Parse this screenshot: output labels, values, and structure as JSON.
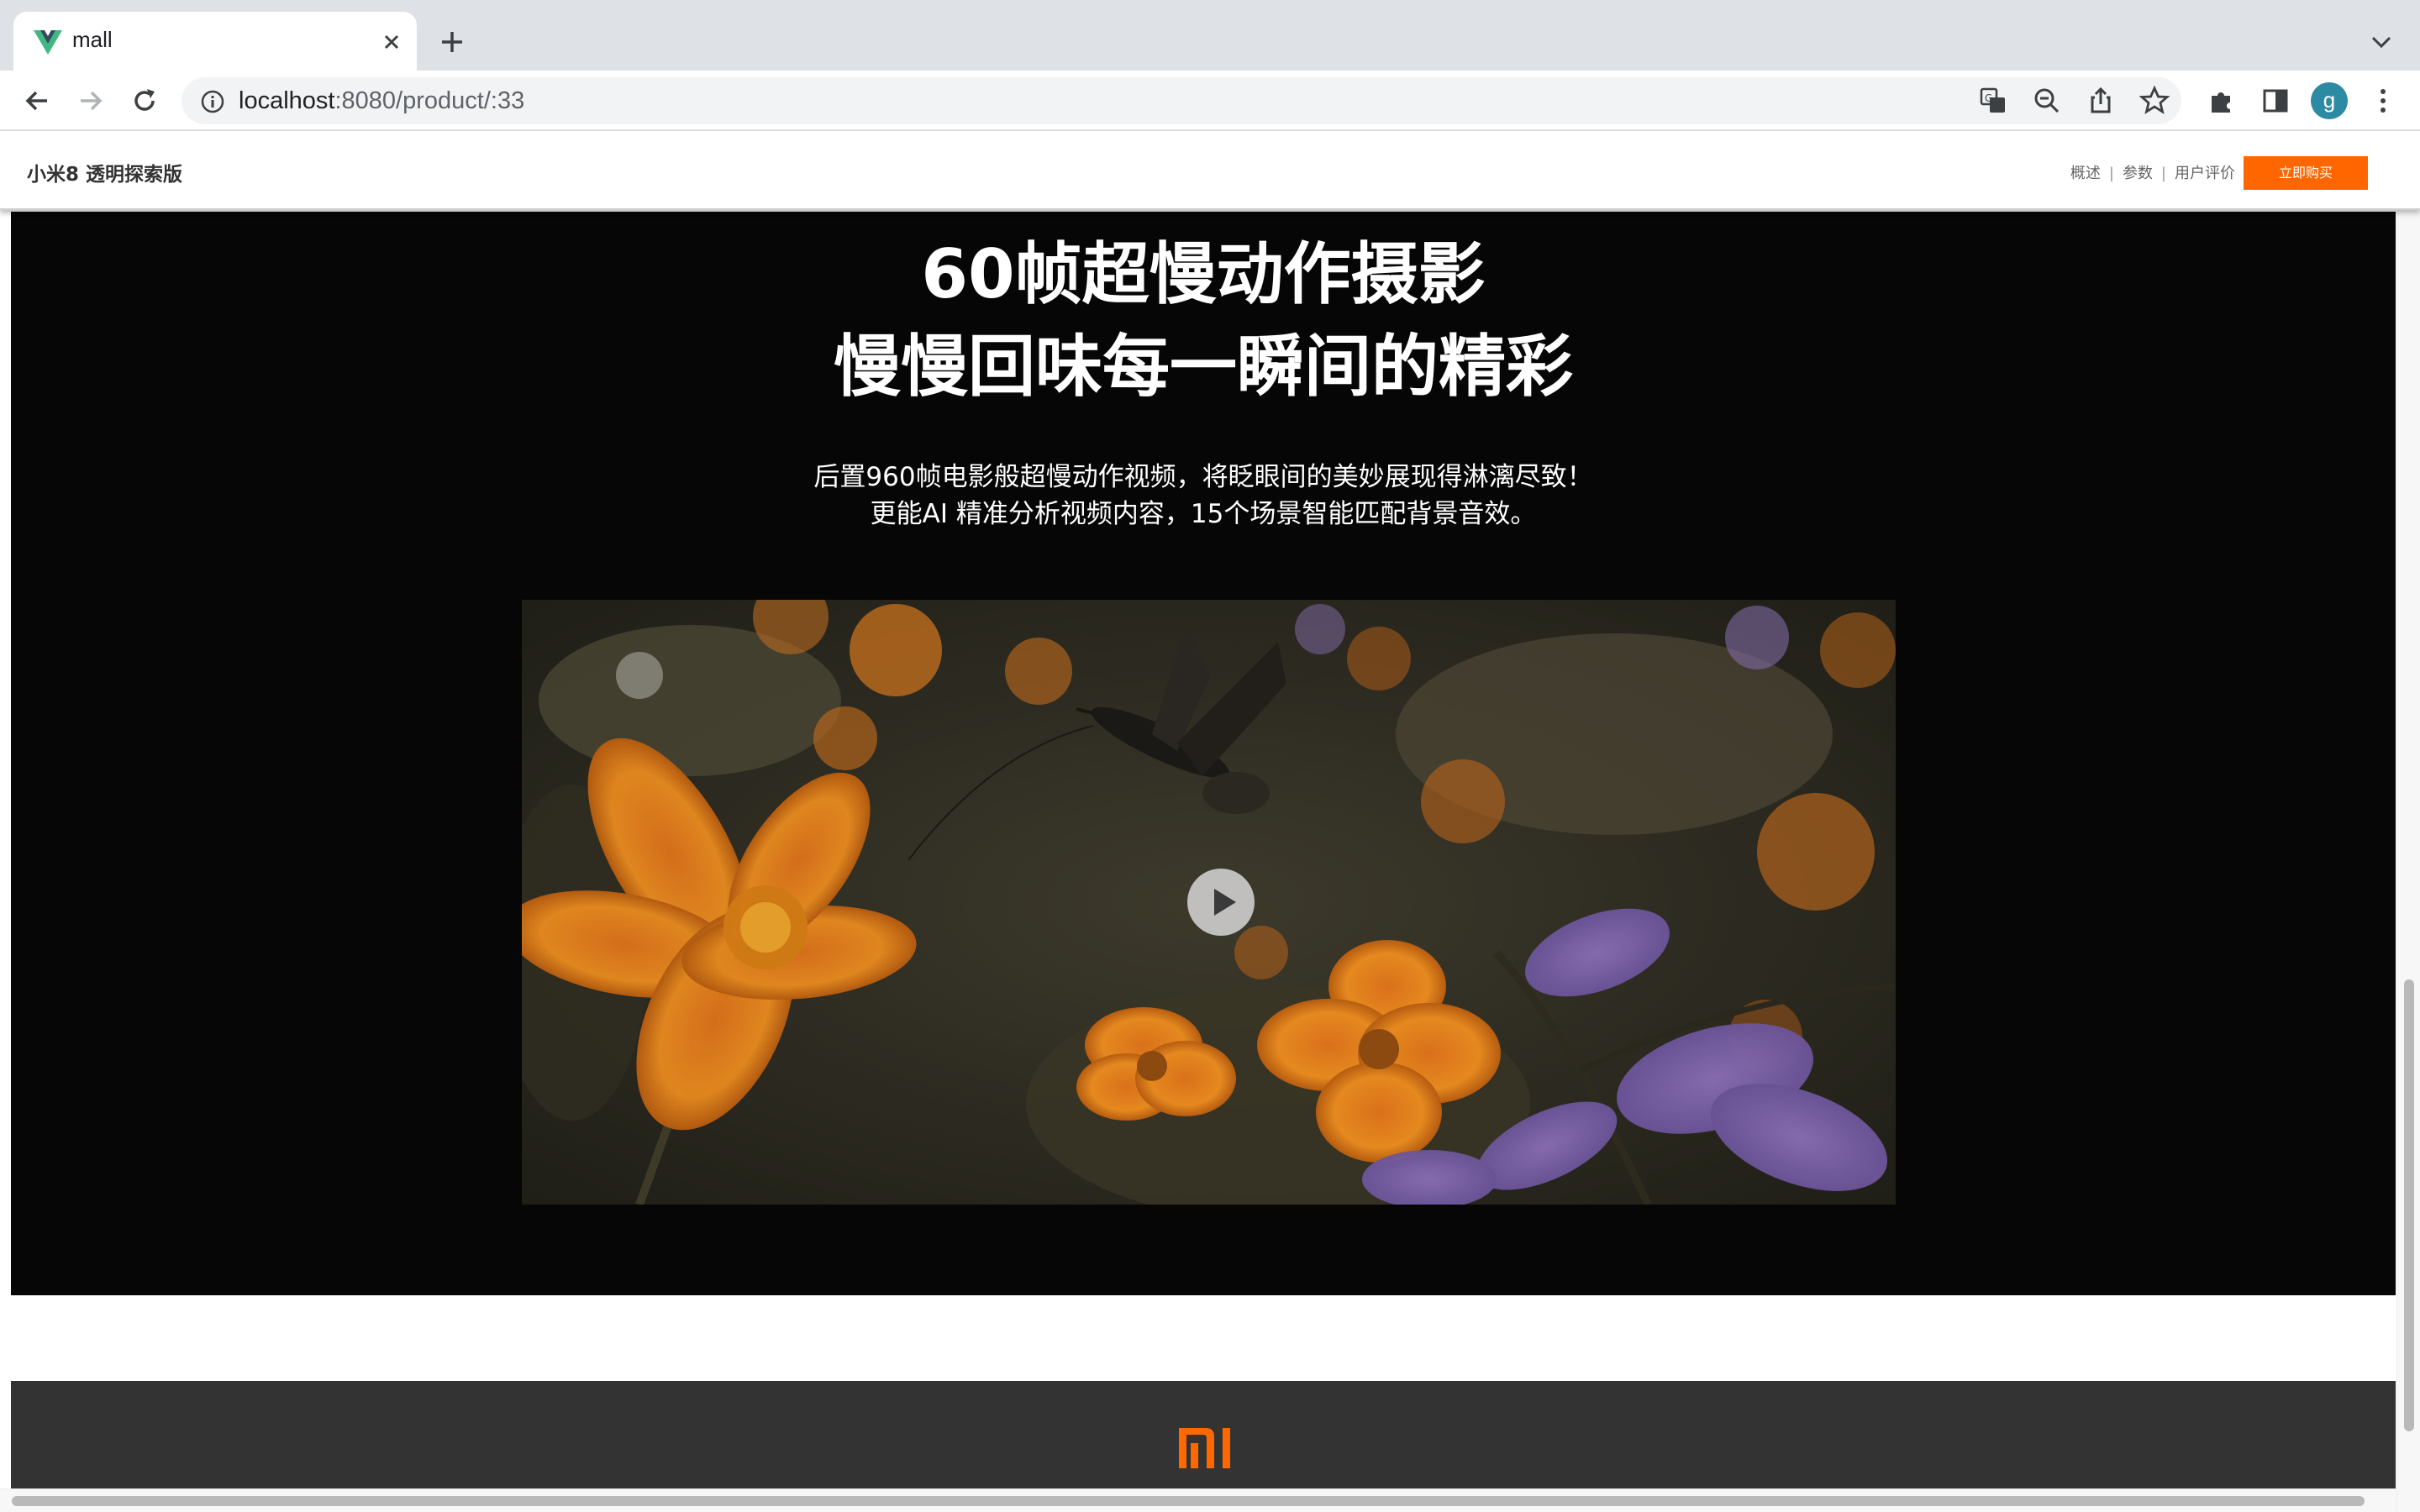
{
  "browser": {
    "tab_title": "mall",
    "url_host": "localhost",
    "url_rest": ":8080/product/:33",
    "profile_initial": "g"
  },
  "product_nav": {
    "product_name": "小米8 透明探索版",
    "links": [
      "概述",
      "参数",
      "用户评价"
    ],
    "separator": "|",
    "buy_label": "立即购买",
    "accent_color": "#ff6600"
  },
  "feature": {
    "headline_line1": "60帧超慢动作摄影",
    "headline_line2": "慢慢回味每一瞬间的精彩",
    "sub_line1": "后置960帧电影般超慢动作视频，将眨眼间的美妙展现得淋漓尽致！",
    "sub_line2": "更能AI 精准分析视频内容，15个场景智能匹配背景音效。",
    "video_icon": "play-icon"
  },
  "footer": {
    "logo_icon": "mi-logo",
    "logo_color": "#ff6700"
  }
}
